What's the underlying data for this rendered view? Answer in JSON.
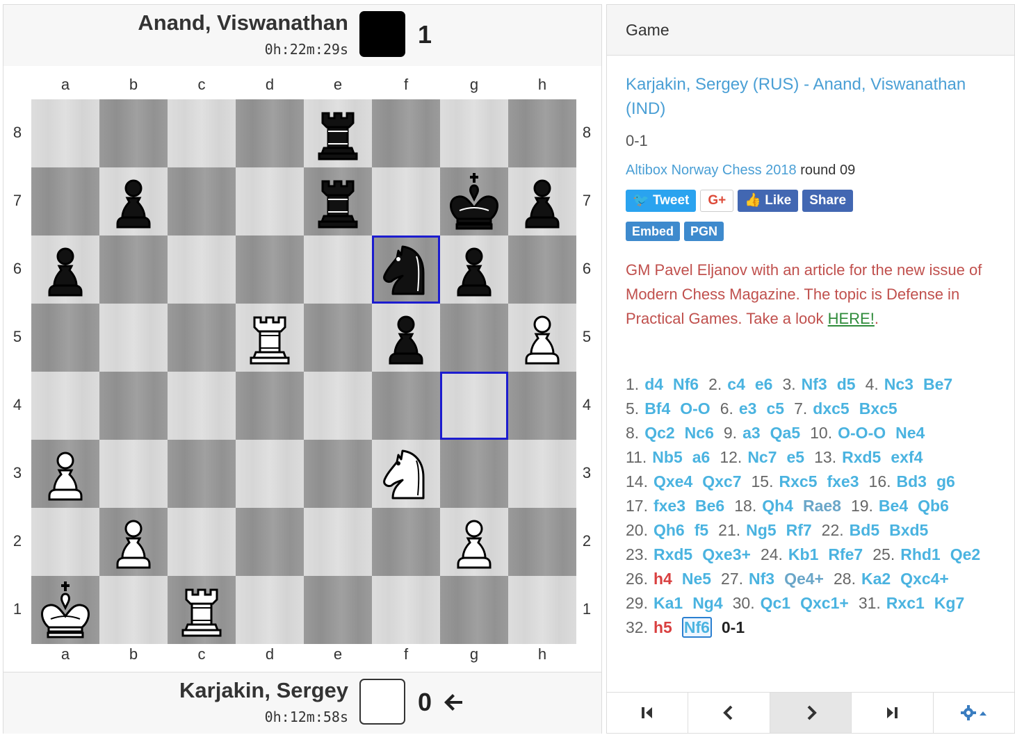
{
  "top_player": {
    "name": "Anand, Viswanathan",
    "clock": "0h:22m:29s",
    "score": "1",
    "color": "#000000"
  },
  "bottom_player": {
    "name": "Karjakin, Sergey",
    "clock": "0h:12m:58s",
    "score": "0",
    "color": "#ffffff"
  },
  "files": [
    "a",
    "b",
    "c",
    "d",
    "e",
    "f",
    "g",
    "h"
  ],
  "ranks": [
    "8",
    "7",
    "6",
    "5",
    "4",
    "3",
    "2",
    "1"
  ],
  "position": [
    {
      "square": "e8",
      "piece": "rook",
      "color": "black"
    },
    {
      "square": "b7",
      "piece": "pawn",
      "color": "black"
    },
    {
      "square": "e7",
      "piece": "rook",
      "color": "black"
    },
    {
      "square": "g7",
      "piece": "king",
      "color": "black"
    },
    {
      "square": "h7",
      "piece": "pawn",
      "color": "black"
    },
    {
      "square": "a6",
      "piece": "pawn",
      "color": "black"
    },
    {
      "square": "f6",
      "piece": "knight",
      "color": "black"
    },
    {
      "square": "g6",
      "piece": "pawn",
      "color": "black"
    },
    {
      "square": "d5",
      "piece": "rook",
      "color": "white"
    },
    {
      "square": "f5",
      "piece": "pawn",
      "color": "black"
    },
    {
      "square": "h5",
      "piece": "pawn",
      "color": "white"
    },
    {
      "square": "a3",
      "piece": "pawn",
      "color": "white"
    },
    {
      "square": "f3",
      "piece": "knight",
      "color": "white"
    },
    {
      "square": "b2",
      "piece": "pawn",
      "color": "white"
    },
    {
      "square": "g2",
      "piece": "pawn",
      "color": "white"
    },
    {
      "square": "a1",
      "piece": "king",
      "color": "white"
    },
    {
      "square": "c1",
      "piece": "rook",
      "color": "white"
    }
  ],
  "highlights": [
    "f6",
    "g4"
  ],
  "panel": {
    "header": "Game",
    "white_player": "Karjakin, Sergey (RUS)",
    "title_sep": " - ",
    "black_player": "Anand, Viswanathan (IND)",
    "result": "0-1",
    "event_link": "Altibox Norway Chess 2018",
    "round": " round 09",
    "buttons": {
      "tweet": "Tweet",
      "gplus": "G+",
      "like": "Like",
      "share": "Share",
      "embed": "Embed",
      "pgn": "PGN"
    },
    "promo_text": "GM Pavel Eljanov with an article for the new issue of Modern Chess Magazine. The topic is Defense in Practical Games. Take a look ",
    "promo_link": "HERE!",
    "promo_end": "."
  },
  "moves": [
    [
      "1.",
      "d4",
      "Nf6"
    ],
    [
      "2.",
      "c4",
      "e6"
    ],
    [
      "3.",
      "Nf3",
      "d5"
    ],
    [
      "4.",
      "Nc3",
      "Be7"
    ],
    [
      "5.",
      "Bf4",
      "O-O"
    ],
    [
      "6.",
      "e3",
      "c5"
    ],
    [
      "7.",
      "dxc5",
      "Bxc5"
    ],
    [
      "8.",
      "Qc2",
      "Nc6"
    ],
    [
      "9.",
      "a3",
      "Qa5"
    ],
    [
      "10.",
      "O-O-O",
      "Ne4"
    ],
    [
      "11.",
      "Nb5",
      "a6"
    ],
    [
      "12.",
      "Nc7",
      "e5"
    ],
    [
      "13.",
      "Rxd5",
      "exf4"
    ],
    [
      "14.",
      "Qxe4",
      "Qxc7"
    ],
    [
      "15.",
      "Rxc5",
      "fxe3"
    ],
    [
      "16.",
      "Bd3",
      "g6"
    ],
    [
      "17.",
      "fxe3",
      "Be6"
    ],
    [
      "18.",
      "Qh4",
      "Rae8"
    ],
    [
      "19.",
      "Be4",
      "Qb6"
    ],
    [
      "20.",
      "Qh6",
      "f5"
    ],
    [
      "21.",
      "Ng5",
      "Rf7"
    ],
    [
      "22.",
      "Bd5",
      "Bxd5"
    ],
    [
      "23.",
      "Rxd5",
      "Qxe3+"
    ],
    [
      "24.",
      "Kb1",
      "Rfe7"
    ],
    [
      "25.",
      "Rhd1",
      "Qe2"
    ],
    [
      "26.",
      "h4",
      "Ne5"
    ],
    [
      "27.",
      "Nf3",
      "Qe4+"
    ],
    [
      "28.",
      "Ka2",
      "Qxc4+"
    ],
    [
      "29.",
      "Ka1",
      "Ng4"
    ],
    [
      "30.",
      "Qc1",
      "Qxc1+"
    ],
    [
      "31.",
      "Rxc1",
      "Kg7"
    ],
    [
      "32.",
      "h5",
      "Nf6"
    ]
  ],
  "move_rows": [
    [
      0,
      1,
      2,
      3
    ],
    [
      4,
      5,
      6
    ],
    [
      7,
      8,
      9
    ],
    [
      10,
      11,
      12
    ],
    [
      13,
      14,
      15
    ],
    [
      16,
      17,
      18
    ],
    [
      19,
      20,
      21
    ],
    [
      22,
      23,
      24
    ],
    [
      25,
      26,
      27
    ],
    [
      28,
      29,
      30
    ],
    [
      31
    ]
  ],
  "final_result": "0-1",
  "nav": [
    "first-move",
    "previous-move",
    "next-move",
    "last-move",
    "settings"
  ]
}
